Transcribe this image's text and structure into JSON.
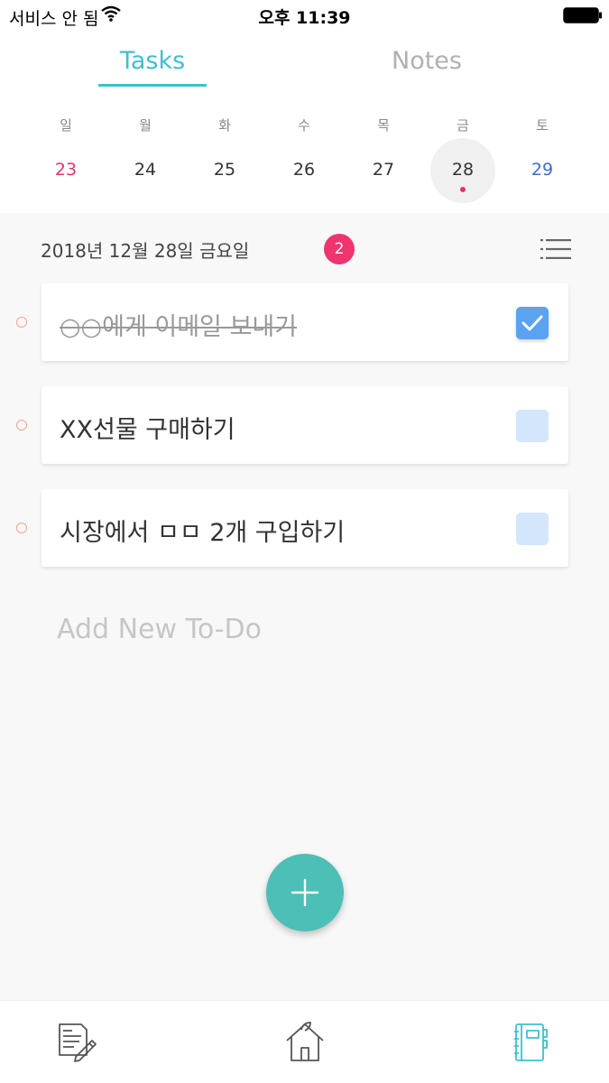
{
  "status_bar": {
    "carrier": "서비스 안 됨",
    "time": "오후 11:39"
  },
  "tabs": [
    {
      "label": "Tasks",
      "active": true
    },
    {
      "label": "Notes",
      "active": false
    }
  ],
  "calendar": {
    "weekdays": [
      "일",
      "월",
      "화",
      "수",
      "목",
      "금",
      "토"
    ],
    "days": [
      "23",
      "24",
      "25",
      "26",
      "27",
      "28",
      "29"
    ],
    "selected_index": 5
  },
  "date_header": {
    "title": "2018년 12월 28일 금요일",
    "count": "2"
  },
  "tasks": [
    {
      "text": "○○에게 이메일 보내기",
      "done": true
    },
    {
      "text": "XX선물 구매하기",
      "done": false
    },
    {
      "text": "시장에서 ㅁㅁ 2개 구입하기",
      "done": false
    }
  ],
  "add_placeholder": "Add New To-Do",
  "icons": {
    "wifi": "wifi-icon",
    "battery": "battery-icon",
    "list": "list-icon",
    "checkmark": "checkmark-icon",
    "plus": "plus-icon",
    "nav_notes": "document-pen-icon",
    "nav_home": "house-icon",
    "nav_notebook": "notebook-icon"
  },
  "colors": {
    "accent_teal": "#3fbfd0",
    "fab": "#4cbfb6",
    "badge_pink": "#ef3470",
    "sunday": "#e53270",
    "saturday": "#3a6fd0",
    "checkbox_checked": "#5aa3f1",
    "checkbox_unchecked": "#d3e6fb"
  }
}
